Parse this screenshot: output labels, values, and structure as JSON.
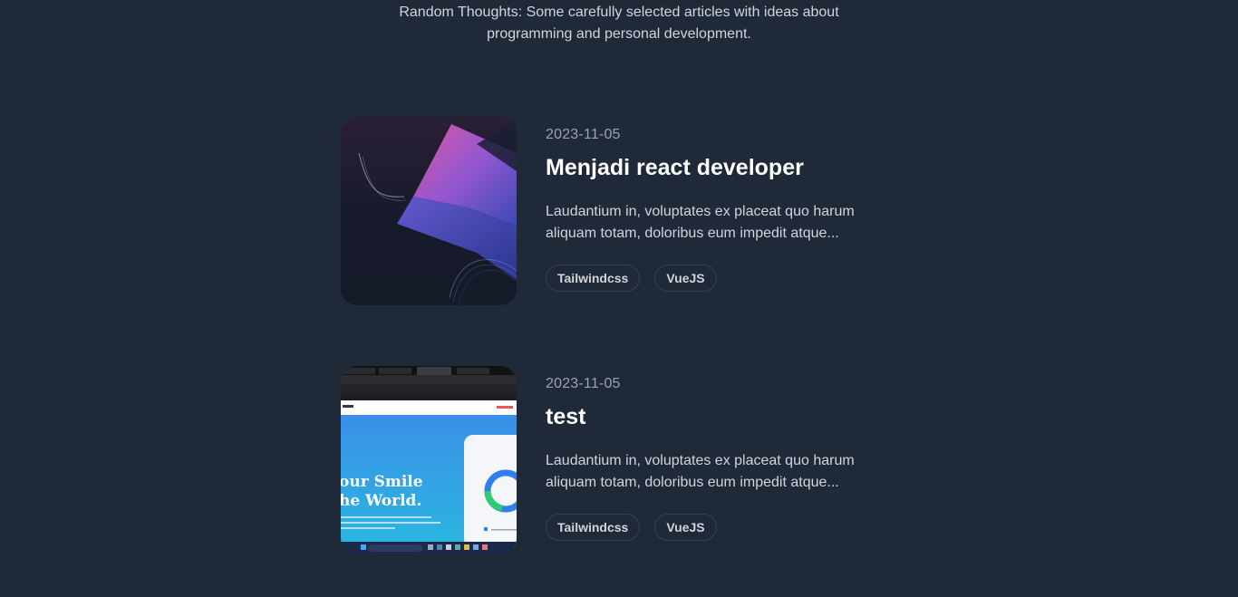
{
  "intro": {
    "line1": "Random Thoughts: Some carefully selected articles with ideas about",
    "line2": "programming and personal development."
  },
  "articles": [
    {
      "date": "2023-11-05",
      "title": "Menjadi react developer",
      "excerpt_line1": "Laudantium in, voluptates ex placeat quo harum",
      "excerpt_line2": "aliquam totam, doloribus eum impedit atque...",
      "tags": [
        "Tailwindcss",
        "VueJS"
      ]
    },
    {
      "date": "2023-11-05",
      "title": "test",
      "excerpt_line1": "Laudantium in, voluptates ex placeat quo harum",
      "excerpt_line2": "aliquam totam, doloribus eum impedit atque...",
      "tags": [
        "Tailwindcss",
        "VueJS"
      ],
      "thumbnail_text": {
        "headline_line1": "our Smile",
        "headline_line2": "he World."
      }
    }
  ]
}
